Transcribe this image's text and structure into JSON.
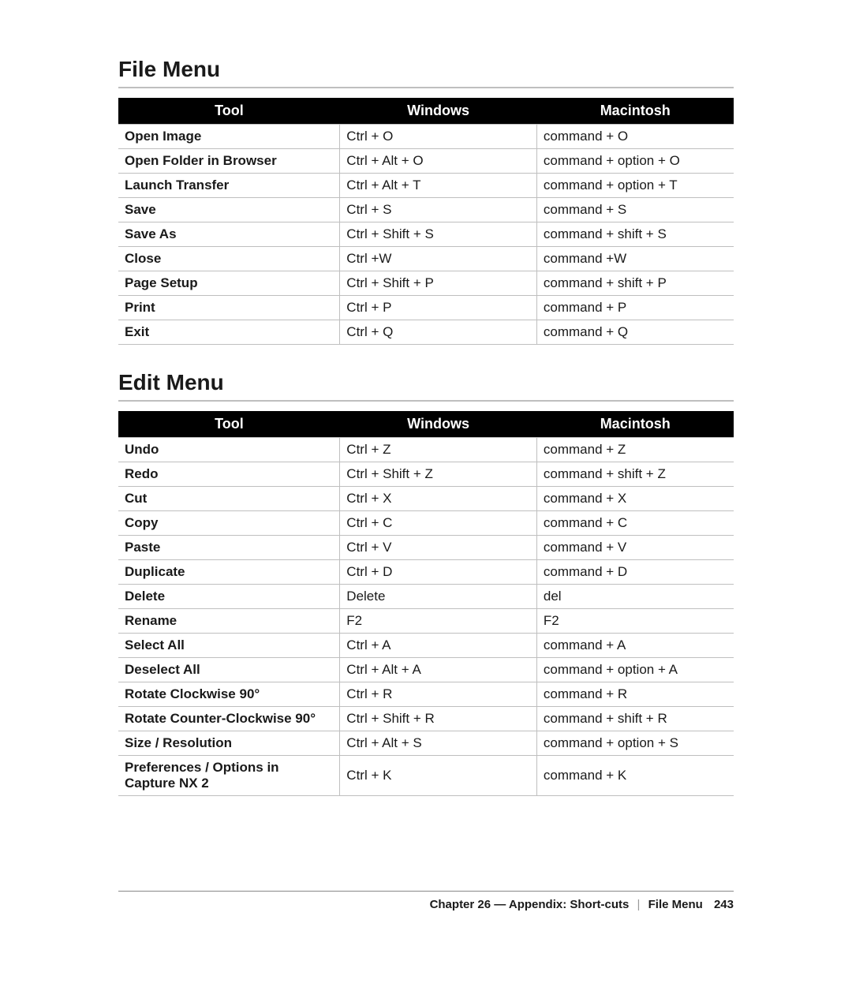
{
  "sections": [
    {
      "title": "File Menu",
      "headers": [
        "Tool",
        "Windows",
        "Macintosh"
      ],
      "rows": [
        {
          "tool": "Open Image",
          "win": "Ctrl + O",
          "mac": "command + O"
        },
        {
          "tool": "Open Folder in Browser",
          "win": "Ctrl + Alt + O",
          "mac": "command + option + O"
        },
        {
          "tool": "Launch Transfer",
          "win": "Ctrl + Alt + T",
          "mac": "command + option + T"
        },
        {
          "tool": "Save",
          "win": "Ctrl + S",
          "mac": "command + S"
        },
        {
          "tool": "Save As",
          "win": "Ctrl + Shift + S",
          "mac": "command + shift + S"
        },
        {
          "tool": "Close",
          "win": "Ctrl +W",
          "mac": "command +W"
        },
        {
          "tool": "Page Setup",
          "win": "Ctrl + Shift + P",
          "mac": "command + shift + P"
        },
        {
          "tool": "Print",
          "win": "Ctrl + P",
          "mac": "command + P"
        },
        {
          "tool": "Exit",
          "win": "Ctrl + Q",
          "mac": "command + Q"
        }
      ]
    },
    {
      "title": "Edit Menu",
      "headers": [
        "Tool",
        "Windows",
        "Macintosh"
      ],
      "rows": [
        {
          "tool": "Undo",
          "win": "Ctrl + Z",
          "mac": "command + Z"
        },
        {
          "tool": "Redo",
          "win": "Ctrl + Shift + Z",
          "mac": "command + shift + Z"
        },
        {
          "tool": "Cut",
          "win": "Ctrl + X",
          "mac": "command + X"
        },
        {
          "tool": "Copy",
          "win": "Ctrl + C",
          "mac": "command + C"
        },
        {
          "tool": "Paste",
          "win": "Ctrl + V",
          "mac": "command + V"
        },
        {
          "tool": "Duplicate",
          "win": "Ctrl + D",
          "mac": "command + D"
        },
        {
          "tool": "Delete",
          "win": "Delete",
          "mac": "del"
        },
        {
          "tool": "Rename",
          "win": "F2",
          "mac": "F2"
        },
        {
          "tool": "Select All",
          "win": "Ctrl + A",
          "mac": "command + A"
        },
        {
          "tool": "Deselect All",
          "win": "Ctrl + Alt + A",
          "mac": "command + option + A"
        },
        {
          "tool": "Rotate Clockwise 90°",
          "win": "Ctrl + R",
          "mac": "command + R"
        },
        {
          "tool": "Rotate Counter-Clockwise 90°",
          "win": "Ctrl + Shift + R",
          "mac": "command + shift + R"
        },
        {
          "tool": "Size / Resolution",
          "win": "Ctrl + Alt + S",
          "mac": "command + option + S"
        },
        {
          "tool": "Preferences / Options in Capture NX 2",
          "win": "Ctrl + K",
          "mac": "command + K"
        }
      ]
    }
  ],
  "footer": {
    "chapter": "Chapter 26 — Appendix: Short-cuts",
    "section": "File Menu",
    "page": "243"
  }
}
